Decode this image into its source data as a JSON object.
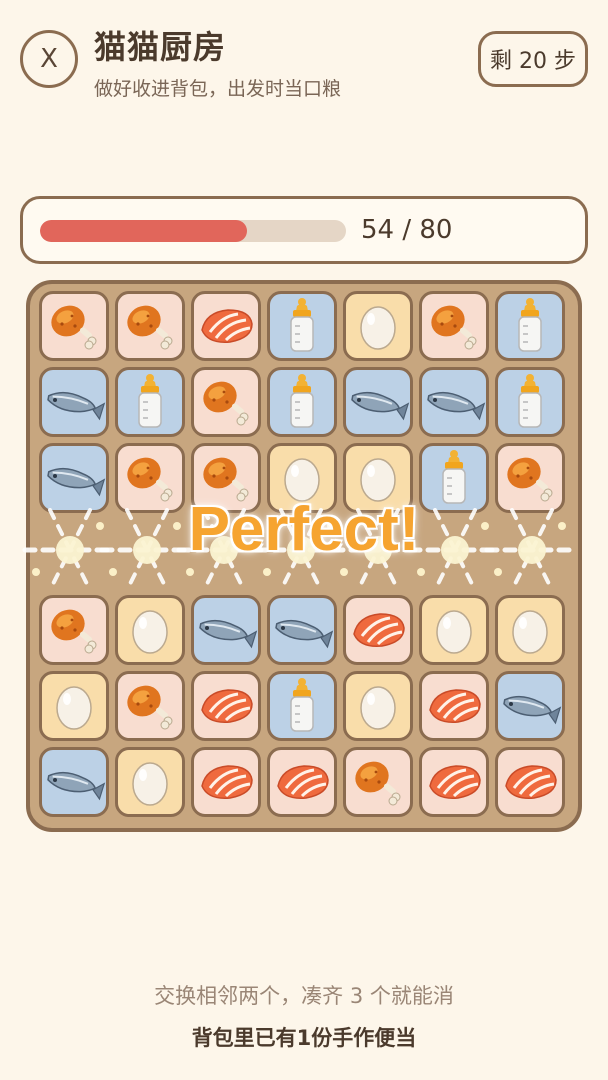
{
  "header": {
    "close_label": "X",
    "title": "猫猫厨房",
    "subtitle": "做好收进背包，出发时当口粮",
    "steps_label": "剩 20 步"
  },
  "progress": {
    "current": 54,
    "total": 80,
    "text": "54 / 80",
    "fill_color": "#e1665b"
  },
  "board": {
    "rows": [
      [
        "chicken",
        "chicken",
        "salmon",
        "bottle",
        "egg",
        "chicken",
        "bottle"
      ],
      [
        "fish",
        "bottle",
        "chicken",
        "bottle",
        "fish",
        "fish",
        "bottle"
      ],
      [
        "fish",
        "chicken",
        "chicken",
        "egg",
        "egg",
        "bottle",
        "chicken"
      ],
      [
        null,
        null,
        null,
        null,
        null,
        null,
        null
      ],
      [
        "chicken",
        "egg",
        "fish",
        "fish",
        "salmon",
        "egg",
        "egg"
      ],
      [
        "egg",
        "chicken",
        "salmon",
        "bottle",
        "egg",
        "salmon",
        "fish"
      ],
      [
        "fish",
        "egg",
        "salmon",
        "salmon",
        "chicken",
        "salmon",
        "salmon"
      ]
    ]
  },
  "effect": {
    "text": "Perfect!",
    "color": "#f6a430"
  },
  "footer": {
    "hint": "交换相邻两个，凑齐 3 个就能消",
    "status": "背包里已有1份手作便当"
  }
}
